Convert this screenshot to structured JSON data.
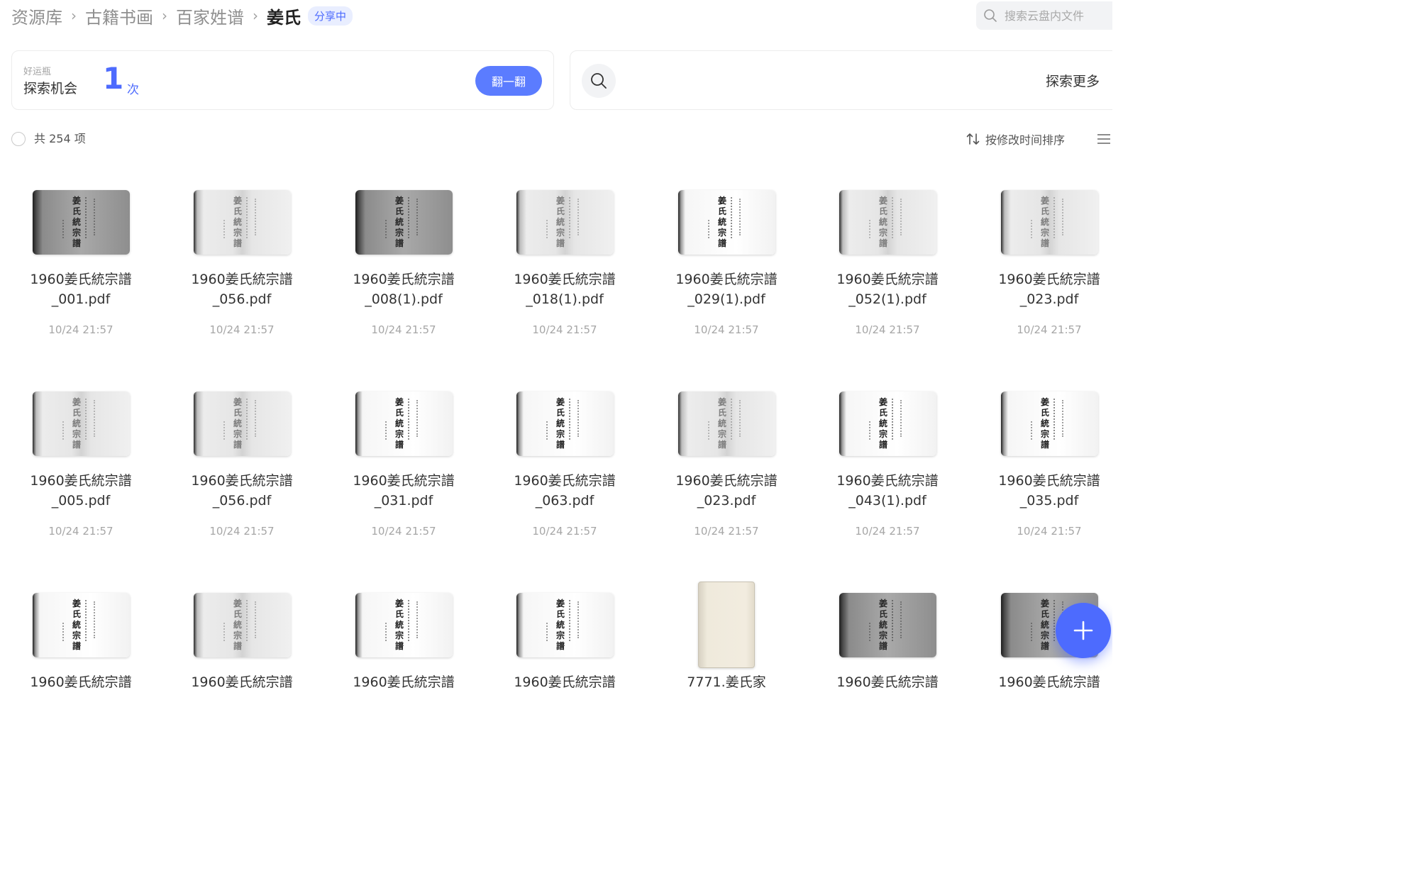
{
  "breadcrumb": {
    "items": [
      "资源库",
      "古籍书画",
      "百家姓谱"
    ],
    "current": "姜氏",
    "badge": "分享中"
  },
  "search": {
    "placeholder": "搜索云盘内文件"
  },
  "lucky_card": {
    "small_label": "好运瓶",
    "label": "探索机会",
    "count": "1",
    "unit": "次",
    "button": "翻一翻"
  },
  "explore_card": {
    "label": "探索更多"
  },
  "toolbar": {
    "total": "共 254 项",
    "sort": "按修改时间排序"
  },
  "files": [
    {
      "name1": "1960姜氏統宗譜",
      "name2": "_001.pdf",
      "date": "10/24 21:57",
      "thumb": "gray"
    },
    {
      "name1": "1960姜氏統宗譜",
      "name2": "_056.pdf",
      "date": "10/24 21:57",
      "thumb": "faded"
    },
    {
      "name1": "1960姜氏統宗譜",
      "name2": "_008(1).pdf",
      "date": "10/24 21:57",
      "thumb": "gray"
    },
    {
      "name1": "1960姜氏統宗譜",
      "name2": "_018(1).pdf",
      "date": "10/24 21:57",
      "thumb": "faded"
    },
    {
      "name1": "1960姜氏統宗譜",
      "name2": "_029(1).pdf",
      "date": "10/24 21:57",
      "thumb": "white"
    },
    {
      "name1": "1960姜氏統宗譜",
      "name2": "_052(1).pdf",
      "date": "10/24 21:57",
      "thumb": "faded"
    },
    {
      "name1": "1960姜氏統宗譜",
      "name2": "_023.pdf",
      "date": "10/24 21:57",
      "thumb": "faded"
    },
    {
      "name1": "1960姜氏統宗譜",
      "name2": "_005.pdf",
      "date": "10/24 21:57",
      "thumb": "faded"
    },
    {
      "name1": "1960姜氏統宗譜",
      "name2": "_056.pdf",
      "date": "10/24 21:57",
      "thumb": "faded"
    },
    {
      "name1": "1960姜氏統宗譜",
      "name2": "_031.pdf",
      "date": "10/24 21:57",
      "thumb": "white"
    },
    {
      "name1": "1960姜氏統宗譜",
      "name2": "_063.pdf",
      "date": "10/24 21:57",
      "thumb": "white"
    },
    {
      "name1": "1960姜氏統宗譜",
      "name2": "_023.pdf",
      "date": "10/24 21:57",
      "thumb": "faded"
    },
    {
      "name1": "1960姜氏統宗譜",
      "name2": "_043(1).pdf",
      "date": "10/24 21:57",
      "thumb": "white"
    },
    {
      "name1": "1960姜氏統宗譜",
      "name2": "_035.pdf",
      "date": "10/24 21:57",
      "thumb": "white"
    },
    {
      "name1": "1960姜氏統宗譜",
      "name2": "",
      "date": "",
      "thumb": "white"
    },
    {
      "name1": "1960姜氏統宗譜",
      "name2": "",
      "date": "",
      "thumb": "faded"
    },
    {
      "name1": "1960姜氏統宗譜",
      "name2": "",
      "date": "",
      "thumb": "white"
    },
    {
      "name1": "1960姜氏統宗譜",
      "name2": "",
      "date": "",
      "thumb": "white"
    },
    {
      "name1": "7771.姜氏家",
      "name2": "",
      "date": "",
      "thumb": "book"
    },
    {
      "name1": "1960姜氏統宗譜",
      "name2": "",
      "date": "",
      "thumb": "gray"
    },
    {
      "name1": "1960姜氏統宗譜",
      "name2": "",
      "date": "",
      "thumb": "gray"
    }
  ],
  "thumb_text": "姜氏統宗譜",
  "colors": {
    "accent": "#4d6bfe",
    "badge_bg": "#e9eeff",
    "muted_text": "#a6a6a6"
  },
  "icons": {
    "search": "search-icon",
    "explore": "search-icon",
    "sort": "sort-arrows-icon",
    "list_view": "list-view-icon",
    "fab": "plus-icon"
  }
}
